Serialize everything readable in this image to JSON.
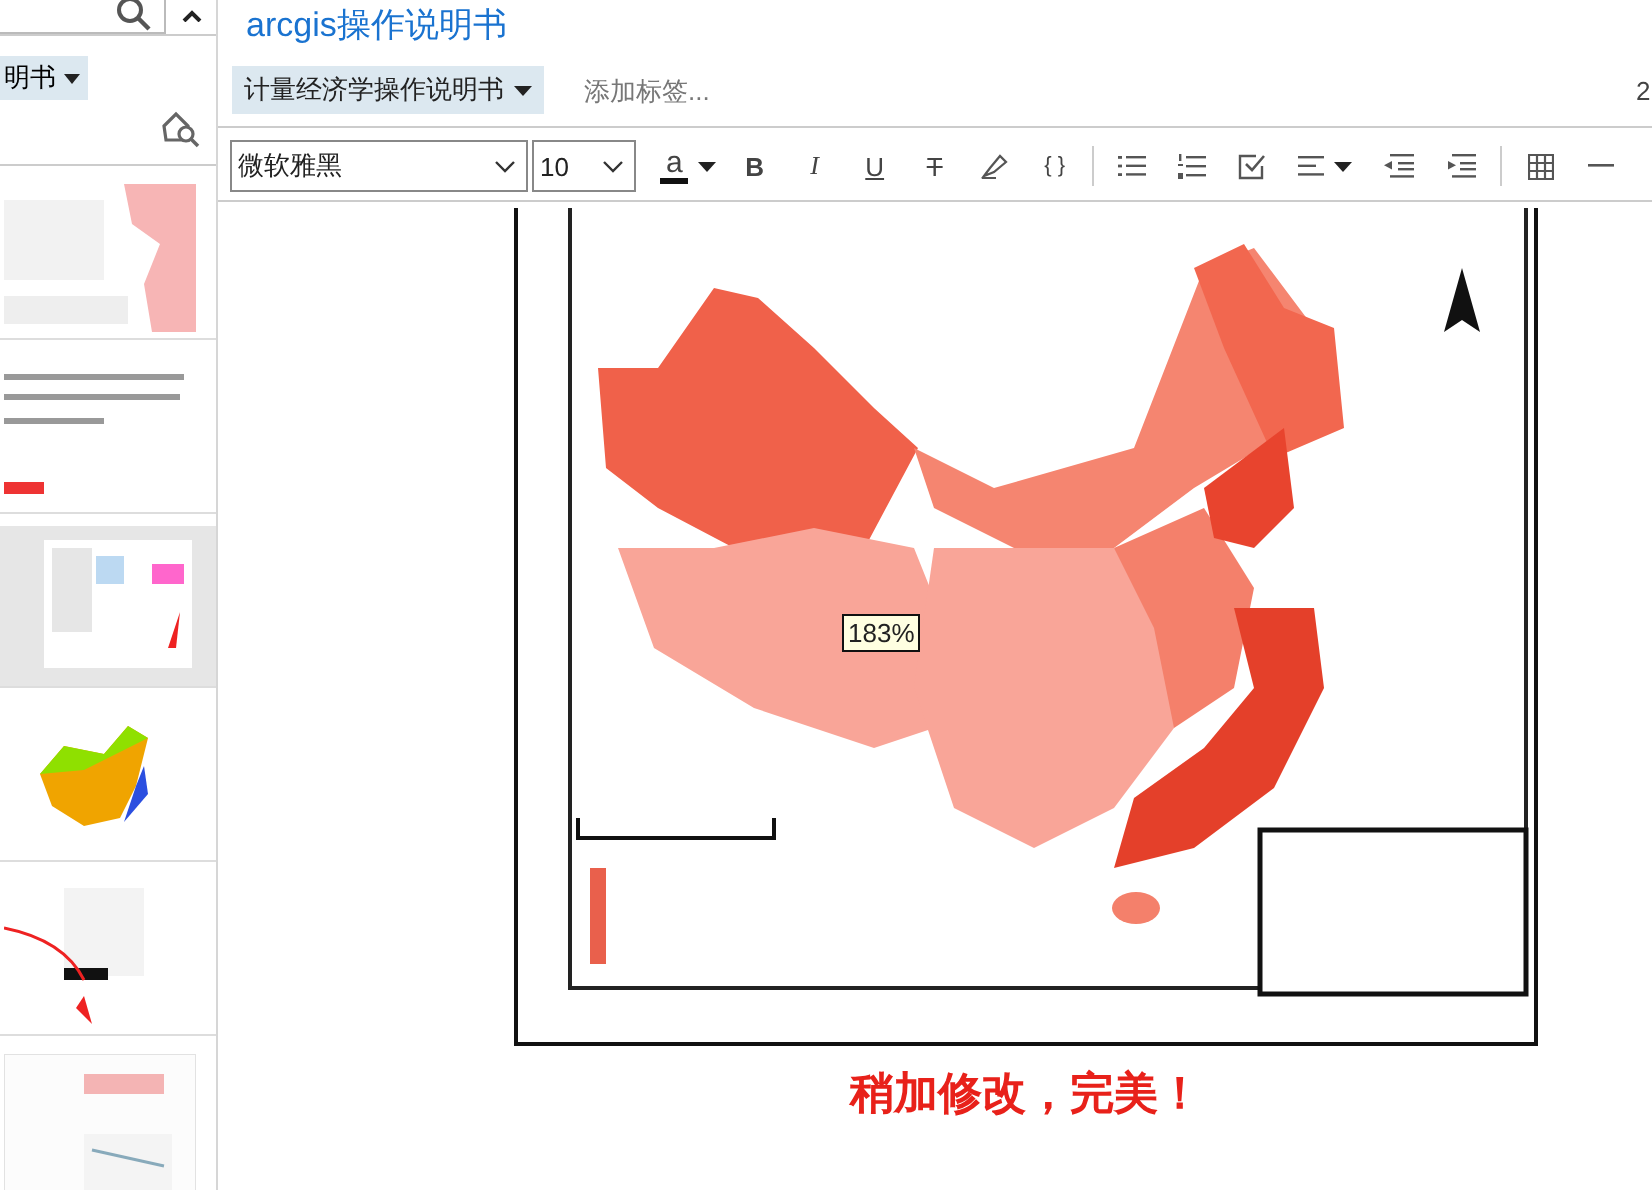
{
  "sidebar": {
    "tag": {
      "label": "明书"
    },
    "thumbnails": [
      {
        "kind": "picture",
        "selected": false
      },
      {
        "kind": "picture",
        "selected": false
      },
      {
        "kind": "picture",
        "selected": true
      },
      {
        "kind": "picture",
        "selected": false
      },
      {
        "kind": "picture",
        "selected": false
      },
      {
        "kind": "picture",
        "selected": false
      }
    ]
  },
  "note": {
    "title": "arcgis操作说明书",
    "notebook": "计量经济学操作说明书",
    "tag_placeholder": "添加标签...",
    "edge_text": "2"
  },
  "toolbar": {
    "font_family": "微软雅黑",
    "font_size": "10",
    "items": [
      {
        "kind": "color",
        "label": "a"
      },
      {
        "kind": "bold",
        "label": "B"
      },
      {
        "kind": "italic",
        "label": "I"
      },
      {
        "kind": "underline",
        "label": "U"
      },
      {
        "kind": "strike",
        "label": "T"
      },
      {
        "kind": "highlight"
      },
      {
        "kind": "code",
        "label": "{ }"
      },
      {
        "kind": "separator"
      },
      {
        "kind": "bullets"
      },
      {
        "kind": "numbers"
      },
      {
        "kind": "checkbox"
      },
      {
        "kind": "align"
      },
      {
        "kind": "outdent"
      },
      {
        "kind": "indent"
      },
      {
        "kind": "separator"
      },
      {
        "kind": "table"
      },
      {
        "kind": "rule"
      }
    ]
  },
  "document": {
    "image": {
      "kind": "picture",
      "zoom_label": "183%"
    },
    "caption": "稍加修改，完美！"
  }
}
